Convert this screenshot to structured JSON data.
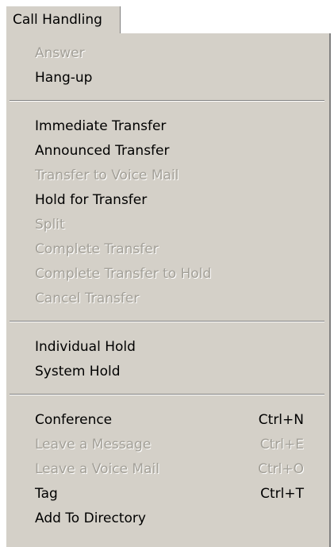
{
  "menubar": {
    "title": "Call Handling"
  },
  "menu": {
    "groups": [
      [
        {
          "label": "Answer",
          "shortcut": "",
          "enabled": false
        },
        {
          "label": "Hang-up",
          "shortcut": "",
          "enabled": true
        }
      ],
      [
        {
          "label": "Immediate Transfer",
          "shortcut": "",
          "enabled": true
        },
        {
          "label": "Announced Transfer",
          "shortcut": "",
          "enabled": true
        },
        {
          "label": "Transfer to Voice Mail",
          "shortcut": "",
          "enabled": false
        },
        {
          "label": "Hold for Transfer",
          "shortcut": "",
          "enabled": true
        },
        {
          "label": "Split",
          "shortcut": "",
          "enabled": false
        },
        {
          "label": "Complete Transfer",
          "shortcut": "",
          "enabled": false
        },
        {
          "label": "Complete Transfer to Hold",
          "shortcut": "",
          "enabled": false
        },
        {
          "label": "Cancel Transfer",
          "shortcut": "",
          "enabled": false
        }
      ],
      [
        {
          "label": "Individual Hold",
          "shortcut": "",
          "enabled": true
        },
        {
          "label": "System Hold",
          "shortcut": "",
          "enabled": true
        }
      ],
      [
        {
          "label": "Conference",
          "shortcut": "Ctrl+N",
          "enabled": true
        },
        {
          "label": "Leave a Message",
          "shortcut": "Ctrl+E",
          "enabled": false
        },
        {
          "label": "Leave a Voice Mail",
          "shortcut": "Ctrl+O",
          "enabled": false
        },
        {
          "label": "Tag",
          "shortcut": "Ctrl+T",
          "enabled": true
        },
        {
          "label": "Add To Directory",
          "shortcut": "",
          "enabled": true
        }
      ]
    ]
  },
  "colors": {
    "menu_background": "#d4d0c8",
    "disabled_text": "#a3a098",
    "enabled_text": "#000000"
  }
}
